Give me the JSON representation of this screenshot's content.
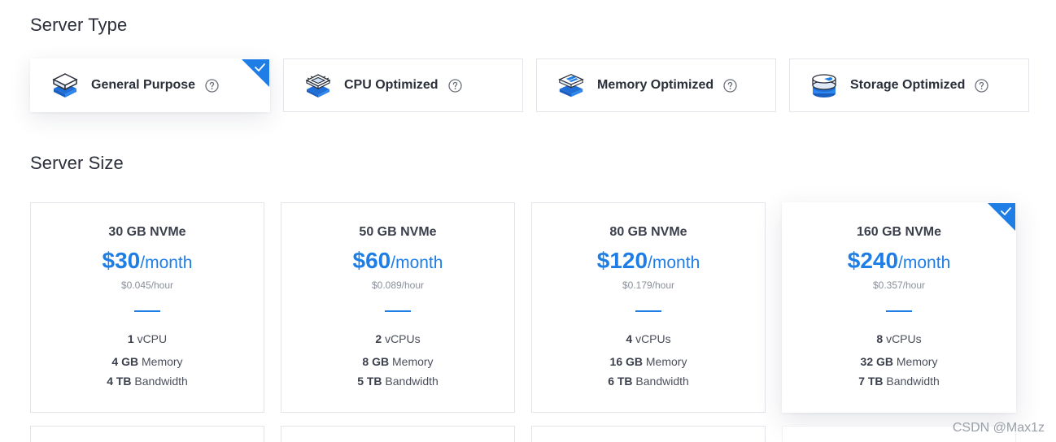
{
  "server_type": {
    "title": "Server Type",
    "selected_index": 0,
    "options": [
      {
        "label": "General Purpose",
        "icon": "stack-layers-icon"
      },
      {
        "label": "CPU Optimized",
        "icon": "cpu-chip-icon"
      },
      {
        "label": "Memory Optimized",
        "icon": "memory-module-icon"
      },
      {
        "label": "Storage Optimized",
        "icon": "storage-disk-icon"
      }
    ]
  },
  "server_size": {
    "title": "Server Size",
    "selected_index": 3,
    "plans": [
      {
        "name": "30 GB NVMe",
        "price": "$30",
        "unit": "/month",
        "hourly": "$0.045/hour",
        "cpu_num": "1",
        "cpu_label": "vCPU",
        "mem_num": "4 GB",
        "mem_label": "Memory",
        "bw_num": "4 TB",
        "bw_label": "Bandwidth"
      },
      {
        "name": "50 GB NVMe",
        "price": "$60",
        "unit": "/month",
        "hourly": "$0.089/hour",
        "cpu_num": "2",
        "cpu_label": "vCPUs",
        "mem_num": "8 GB",
        "mem_label": "Memory",
        "bw_num": "5 TB",
        "bw_label": "Bandwidth"
      },
      {
        "name": "80 GB NVMe",
        "price": "$120",
        "unit": "/month",
        "hourly": "$0.179/hour",
        "cpu_num": "4",
        "cpu_label": "vCPUs",
        "mem_num": "16 GB",
        "mem_label": "Memory",
        "bw_num": "6 TB",
        "bw_label": "Bandwidth"
      },
      {
        "name": "160 GB NVMe",
        "price": "$240",
        "unit": "/month",
        "hourly": "$0.357/hour",
        "cpu_num": "8",
        "cpu_label": "vCPUs",
        "mem_num": "32 GB",
        "mem_label": "Memory",
        "bw_num": "7 TB",
        "bw_label": "Bandwidth"
      }
    ]
  },
  "colors": {
    "accent": "#1e7ee6",
    "border": "#e3e5ea",
    "text": "#2b2f3a"
  },
  "watermark": "CSDN @Max1z"
}
